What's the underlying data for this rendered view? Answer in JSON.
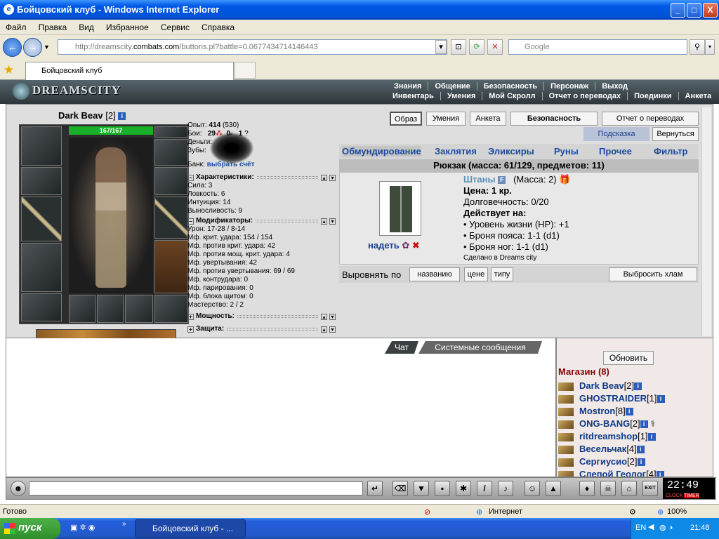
{
  "window": {
    "title": "Бойцовский клуб - Windows Internet Explorer",
    "min": "_",
    "max": "□",
    "close": "X"
  },
  "menu": [
    "Файл",
    "Правка",
    "Вид",
    "Избранное",
    "Сервис",
    "Справка"
  ],
  "address": {
    "url_prefix": "http://dreamscity.",
    "url_domain": "combats.com",
    "url_rest": "/buttons.pl?battle=0.0677434714146443",
    "search_placeholder": "Google"
  },
  "tab": {
    "title": "Бойцовский клуб"
  },
  "game_header": {
    "logo": "DREAMSCITY",
    "nav_top": [
      "Знания",
      "Общение",
      "Безопасность",
      "Персонаж",
      "Выход"
    ],
    "nav_bottom": [
      "Инвентарь",
      "Умения",
      "Мой Скролл",
      "Отчет о переводах",
      "Поединки",
      "Анкета"
    ]
  },
  "character": {
    "name": "Dark Beav",
    "level": "[2]",
    "hp": "167/167",
    "exp_label": "Опыт:",
    "exp": "414",
    "exp_next": "(530)",
    "fights_label": "Бои:",
    "fights_win": "29",
    "fights_lose": "0",
    "fights_draw": "1",
    "fights_q": "?",
    "money_label": "Деньги:",
    "teeth_label": "Зубы:",
    "bank_label": "Банк:",
    "bank_link": "выбрать счёт",
    "characteristics_title": "Характеристики:",
    "stats": [
      "Сила: 3",
      "Ловкость: 6",
      "Интуиция: 14",
      "Выносливость: 9"
    ],
    "modifiers_title": "Модификаторы:",
    "modifiers": [
      "Урон: 17-28 / 8-14",
      "Мф. крит. удара: 154 / 154",
      "Мф. против крит. удара: 42",
      "Мф. против мощ. крит. удара: 4",
      "Мф. увертывания: 42",
      "Мф. против увертывания: 69 / 69",
      "Мф. контрудара: 0",
      "Мф. парирования: 0",
      "Мф. блока щитом: 0",
      "Мастерство: 2 / 2"
    ],
    "power_title": "Мощность:",
    "defense_title": "Защита:"
  },
  "right_buttons": {
    "image": "Образ",
    "skills": "Умения",
    "profile": "Анкета",
    "security": "Безопасность",
    "report": "Отчет о переводах",
    "hint": "Подсказка",
    "back": "Вернуться"
  },
  "inventory": {
    "tabs": [
      "Обмундирование",
      "Заклятия",
      "Эликсиры",
      "Руны",
      "Прочее",
      "Фильтр"
    ],
    "header": "Рюкзак (масса: 61/129, предметов: 11)",
    "item": {
      "name": "Штаны",
      "mass": "(Масса: 2)",
      "price": "Цена: 1 кр.",
      "durability": "Долговечность: 0/20",
      "acts_on": "Действует на:",
      "effects": [
        "• Уровень жизни (HP): +1",
        "• Броня пояса: 1-1 (d1)",
        "• Броня ног: 1-1 (d1)"
      ],
      "made_in": "Сделано в Dreams city",
      "wear": "надеть"
    },
    "sort_label": "Выровнять по",
    "sort_by_name": "названию",
    "sort_by_price": "цене",
    "sort_by_type": "типу",
    "discard": "Выбросить хлам"
  },
  "chat": {
    "tab_chat": "Чат",
    "tab_system": "Системные сообщения"
  },
  "sidebar": {
    "refresh": "Обновить",
    "location": "Магазин (8)",
    "users": [
      {
        "name": "Dark Beav",
        "level": "[2]"
      },
      {
        "name": "GHOSTRAIDER",
        "level": "[1]"
      },
      {
        "name": "Mostron",
        "level": "[8]"
      },
      {
        "name": "ONG-BANG",
        "level": "[2]"
      },
      {
        "name": "ritdreamshop",
        "level": "[1]"
      },
      {
        "name": "Весельчак",
        "level": "[4]"
      },
      {
        "name": "Сергиусио",
        "level": "[2]"
      },
      {
        "name": "Слепой Геолог",
        "level": "[4]"
      }
    ]
  },
  "clock": {
    "time": "22:49",
    "clock_label": "CLOCK",
    "timer_label": "TIMER",
    "exit_label": "EXIT"
  },
  "statusbar": {
    "status": "Готово",
    "zone": "Интернет",
    "zoom": "100%"
  },
  "taskbar": {
    "start": "пуск",
    "task": "Бойцовский клуб - ...",
    "lang": "EN",
    "time": "21:48"
  }
}
